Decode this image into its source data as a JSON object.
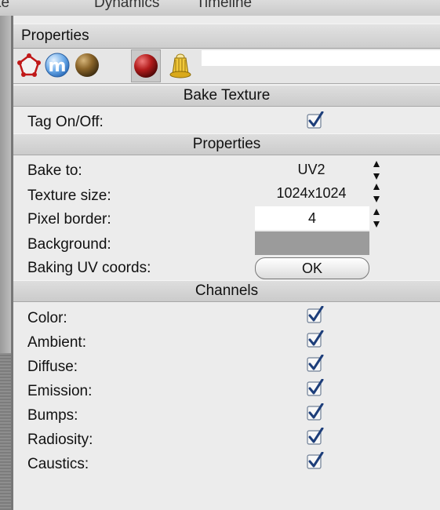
{
  "menubar": {
    "items": [
      "ke",
      "Dynamics",
      "Timeline"
    ]
  },
  "panel": {
    "title": "Properties",
    "tags": [
      {
        "icon": "polygon-tag-icon",
        "selected": false
      },
      {
        "icon": "material-m-tag-icon",
        "selected": false
      },
      {
        "icon": "brown-material-icon",
        "selected": false
      },
      {
        "icon": "red-material-icon",
        "selected": false
      },
      {
        "icon": "bake-texture-tag-icon",
        "selected": true
      }
    ]
  },
  "sections": {
    "bake": "Bake Texture",
    "properties": "Properties",
    "channels": "Channels"
  },
  "bake": {
    "tag_onoff_label": "Tag On/Off:",
    "tag_onoff_checked": true
  },
  "properties": {
    "bake_to_label": "Bake to:",
    "bake_to_value": "UV2",
    "texture_size_label": "Texture size:",
    "texture_size_value": "1024x1024",
    "pixel_border_label": "Pixel border:",
    "pixel_border_value": "4",
    "background_label": "Background:",
    "background_color": "#9b9b9b",
    "baking_uv_label": "Baking UV coords:",
    "baking_uv_button": "OK"
  },
  "channels": [
    {
      "label": "Color:",
      "checked": true
    },
    {
      "label": "Ambient:",
      "checked": true
    },
    {
      "label": "Diffuse:",
      "checked": true
    },
    {
      "label": "Emission:",
      "checked": true
    },
    {
      "label": "Bumps:",
      "checked": true
    },
    {
      "label": "Radiosity:",
      "checked": true
    },
    {
      "label": "Caustics:",
      "checked": true
    }
  ]
}
